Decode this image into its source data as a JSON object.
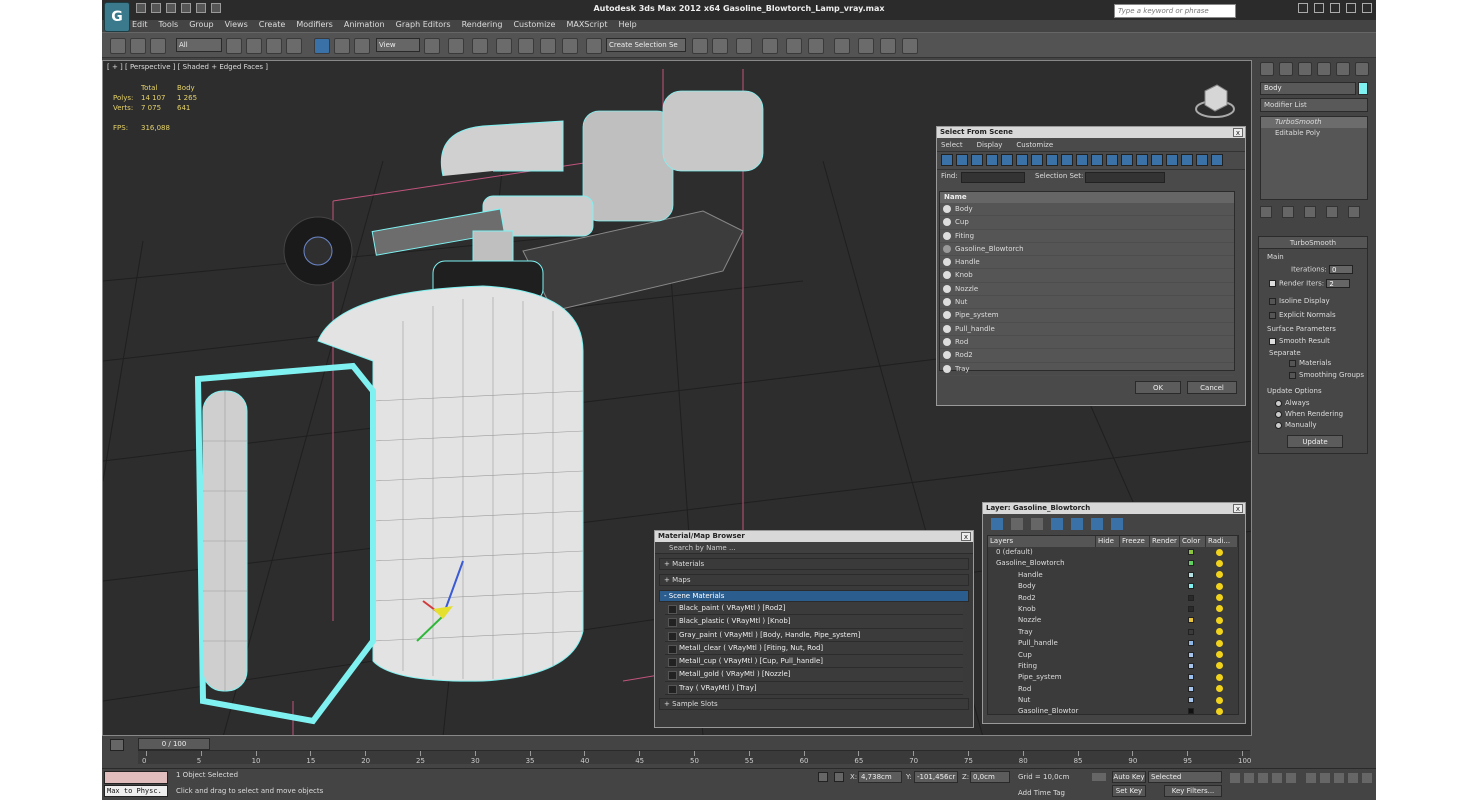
{
  "app": {
    "title": "Autodesk 3ds Max  2012 x64     Gasoline_Blowtorch_Lamp_vray.max",
    "search_placeholder": "Type a keyword or phrase"
  },
  "menu": [
    "Edit",
    "Tools",
    "Group",
    "Views",
    "Create",
    "Modifiers",
    "Animation",
    "Graph Editors",
    "Rendering",
    "Customize",
    "MAXScript",
    "Help"
  ],
  "toolbar": {
    "filter_value": "All",
    "ref_coord": "View",
    "selection_set": "Create Selection Se"
  },
  "viewport": {
    "label": "[ + ] [ Perspective ] [ Shaded + Edged Faces ]",
    "stats": {
      "total_hd": "Total",
      "body_hd": "Body",
      "polys_label": "Polys:",
      "polys_total": "14 107",
      "polys_body": "1 265",
      "verts_label": "Verts:",
      "verts_total": "7 075",
      "verts_body": "641",
      "fps_label": "FPS:",
      "fps_value": "316,088"
    }
  },
  "command_panel": {
    "object_name": "Body",
    "object_color": "#7ff1f1",
    "modifier_list": "Modifier List",
    "stack": [
      "TurboSmooth",
      "Editable Poly"
    ],
    "turbosmooth": {
      "title": "TurboSmooth",
      "main": "Main",
      "iterations_label": "Iterations:",
      "iterations_value": "0",
      "render_iters_label": "Render Iters:",
      "render_iters_value": "2",
      "isoline": "Isoline Display",
      "explicit": "Explicit Normals",
      "surface_params": "Surface Parameters",
      "smooth_result": "Smooth Result",
      "separate": "Separate",
      "materials": "Materials",
      "smoothing_groups": "Smoothing Groups",
      "update_options": "Update Options",
      "always": "Always",
      "when_rendering": "When Rendering",
      "manually": "Manually",
      "update_btn": "Update"
    }
  },
  "select_from_scene": {
    "title": "Select From Scene",
    "menu": [
      "Select",
      "Display",
      "Customize"
    ],
    "find_label": "Find:",
    "selection_set_label": "Selection Set:",
    "name_header": "Name",
    "items": [
      "Body",
      "Cup",
      "Fiting",
      "Gasoline_Blowtorch",
      "Handle",
      "Knob",
      "Nozzle",
      "Nut",
      "Pipe_system",
      "Pull_handle",
      "Rod",
      "Rod2",
      "Tray"
    ],
    "ok": "OK",
    "cancel": "Cancel"
  },
  "material_browser": {
    "title": "Material/Map Browser",
    "search": "Search by Name ...",
    "materials": "+ Materials",
    "maps": "+ Maps",
    "scene_materials": "- Scene Materials",
    "items": [
      "Black_paint  ( VRayMtl ) [Rod2]",
      "Black_plastic  ( VRayMtl ) [Knob]",
      "Gray_paint  ( VRayMtl ) [Body, Handle, Pipe_system]",
      "Metall_clear  ( VRayMtl ) [Fiting, Nut, Rod]",
      "Metall_cup  ( VRayMtl ) [Cup, Pull_handle]",
      "Metall_gold  ( VRayMtl ) [Nozzle]",
      "Tray  ( VRayMtl ) [Tray]"
    ],
    "sample_slots": "+ Sample Slots"
  },
  "layer_dialog": {
    "title": "Layer: Gasoline_Blowtorch",
    "headers": [
      "Layers",
      "Hide",
      "Freeze",
      "Render",
      "Color",
      "Radi..."
    ],
    "rows": [
      {
        "name": "0 (default)",
        "indent": 0,
        "color": "#8cc63f"
      },
      {
        "name": "Gasoline_Blowtorch",
        "indent": 0,
        "color": "#5fd35f"
      },
      {
        "name": "Handle",
        "indent": 1,
        "color": "#b5e3e3"
      },
      {
        "name": "Body",
        "indent": 1,
        "color": "#7ff1f1"
      },
      {
        "name": "Rod2",
        "indent": 1,
        "color": "#2a2a2a"
      },
      {
        "name": "Knob",
        "indent": 1,
        "color": "#2a2a2a"
      },
      {
        "name": "Nozzle",
        "indent": 1,
        "color": "#e6c33a"
      },
      {
        "name": "Tray",
        "indent": 1,
        "color": "#3a3a3a"
      },
      {
        "name": "Pull_handle",
        "indent": 1,
        "color": "#8fb7e8"
      },
      {
        "name": "Cup",
        "indent": 1,
        "color": "#a7c4ec"
      },
      {
        "name": "Fiting",
        "indent": 1,
        "color": "#a7c4ec"
      },
      {
        "name": "Pipe_system",
        "indent": 1,
        "color": "#9cc0f0"
      },
      {
        "name": "Rod",
        "indent": 1,
        "color": "#a7c4ec"
      },
      {
        "name": "Nut",
        "indent": 1,
        "color": "#a7c4ec"
      },
      {
        "name": "Gasoline_Blowtor",
        "indent": 1,
        "color": "#111111"
      }
    ]
  },
  "timeline": {
    "slider": "0 / 100",
    "ticks": [
      "0",
      "5",
      "10",
      "15",
      "20",
      "25",
      "30",
      "35",
      "40",
      "45",
      "50",
      "55",
      "60",
      "65",
      "70",
      "75",
      "80",
      "85",
      "90",
      "95",
      "100"
    ]
  },
  "status": {
    "maxscript": "Max to Physc.",
    "selected": "1 Object Selected",
    "prompt": "Click and drag to select and move objects",
    "x_label": "X:",
    "x_value": "4,738cm",
    "y_label": "Y:",
    "y_value": "-101,456cr",
    "z_label": "Z:",
    "z_value": "0,0cm",
    "grid": "Grid = 10,0cm",
    "add_time_tag": "Add Time Tag",
    "auto_key": "Auto Key",
    "set_key": "Set Key",
    "selected_dropdown": "Selected",
    "key_filters": "Key Filters..."
  }
}
